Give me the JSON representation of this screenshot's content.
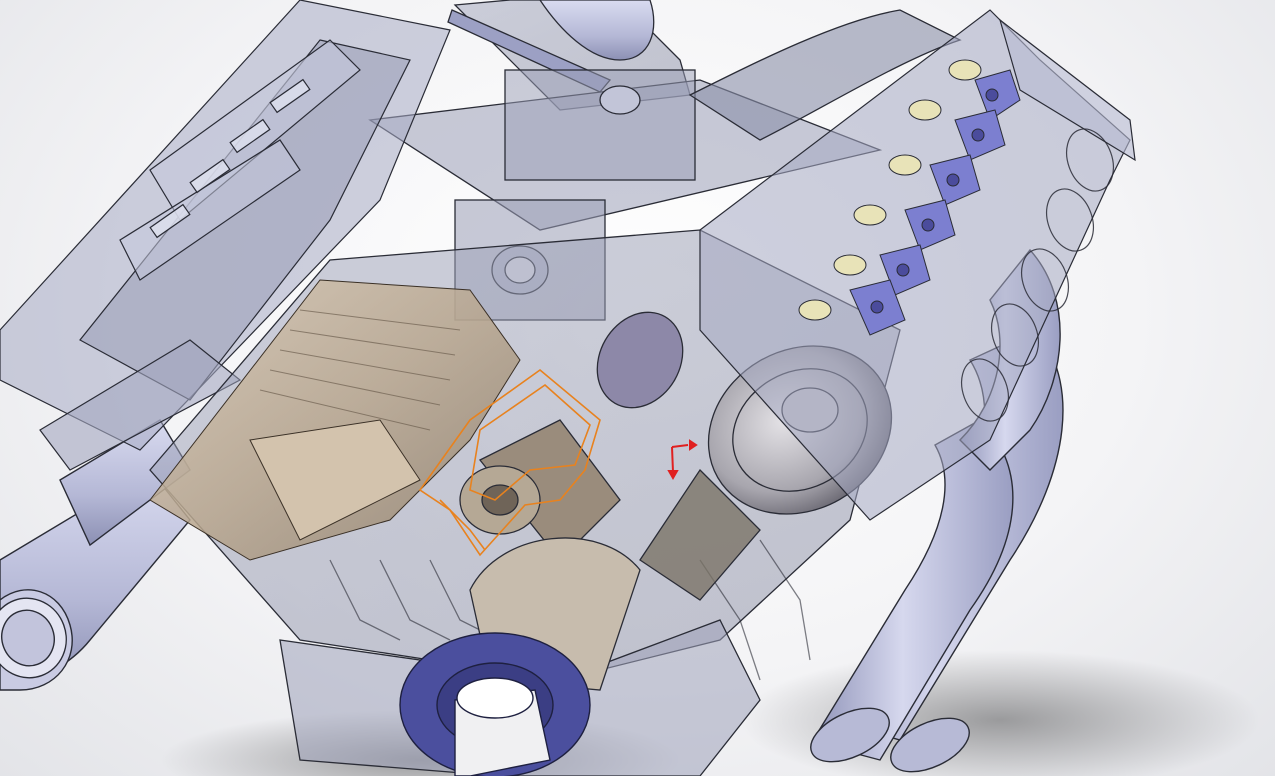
{
  "viewport": {
    "mode": "3d-cad-model-view",
    "render_style": "transparent shaded with edges",
    "background": "#f2f3f6"
  },
  "model": {
    "parts": [
      "left-cylinder-head",
      "right-cylinder-head",
      "intake-manifold",
      "engine-block",
      "piston",
      "connecting-rod",
      "crankshaft-pulley",
      "left-exhaust-header",
      "right-exhaust-header",
      "rocker-arms",
      "selected-part-outline"
    ]
  },
  "colors": {
    "transparent_body": "#8e92a8",
    "edge_lines": "#2a2c36",
    "header_tubes": "#c9cbe3",
    "header_tubes_shade": "#8f93b8",
    "block_internals": "#c7b39a",
    "block_internals_dark": "#8b7a66",
    "rocker_arms": "#7c7fd0",
    "rocker_arms_dark": "#4b4c9c",
    "valve_springs": "#e8e3b8",
    "pulley": "#4b4f9e",
    "pulley_hub": "#f0f0f2",
    "selection_outline": "#e8821e",
    "triad_axis": "#e02020"
  },
  "triad": {
    "axes": [
      "x-axis",
      "y-axis"
    ]
  }
}
